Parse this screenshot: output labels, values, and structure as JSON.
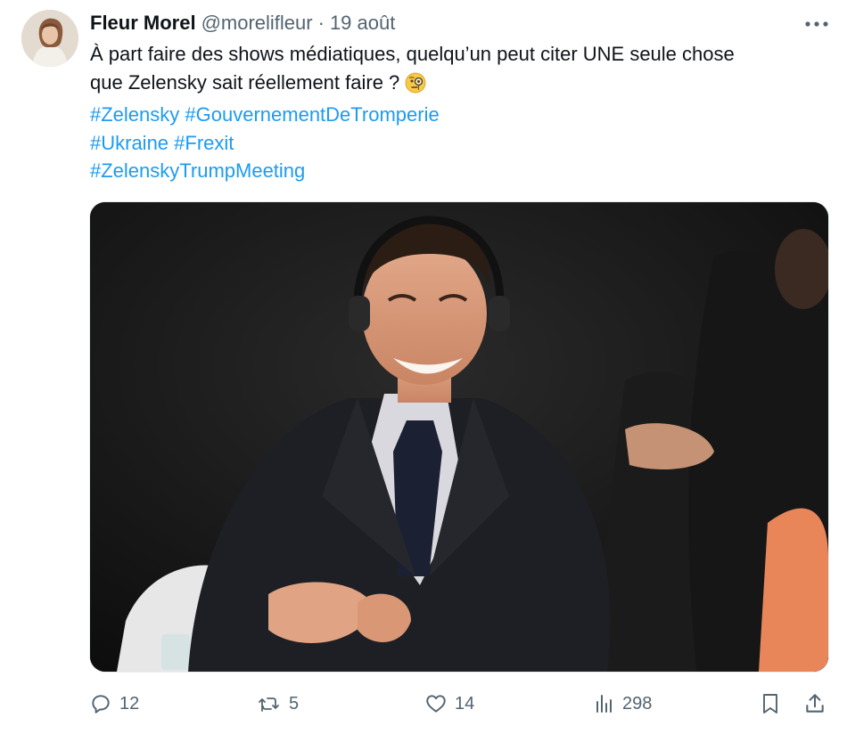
{
  "tweet": {
    "author_name": "Fleur Morel",
    "author_handle": "@morelifleur",
    "separator": "·",
    "date": "19 août",
    "text_line1": "À part faire des shows médiatiques, quelqu’un peut citer UNE seule chose",
    "text_line2": "que Zelensky sait réellement faire ?",
    "emoji": "face-with-monocle",
    "hashtags": {
      "zelensky": "#Zelensky",
      "gouvernement": "#GouvernementDeTromperie",
      "ukraine": "#Ukraine",
      "frexit": "#Frexit",
      "meeting": "#ZelenskyTrumpMeeting"
    }
  },
  "actions": {
    "replies": "12",
    "reposts": "5",
    "likes": "14",
    "views": "298"
  },
  "icons": {
    "more": "more-horizontal-icon",
    "reply": "reply-icon",
    "repost": "repost-icon",
    "like": "heart-icon",
    "views": "views-chart-icon",
    "bookmark": "bookmark-icon",
    "share": "share-icon"
  },
  "colors": {
    "hashtag": "#1d9bf0",
    "secondary_text": "#536471",
    "primary_text": "#0f1419"
  }
}
